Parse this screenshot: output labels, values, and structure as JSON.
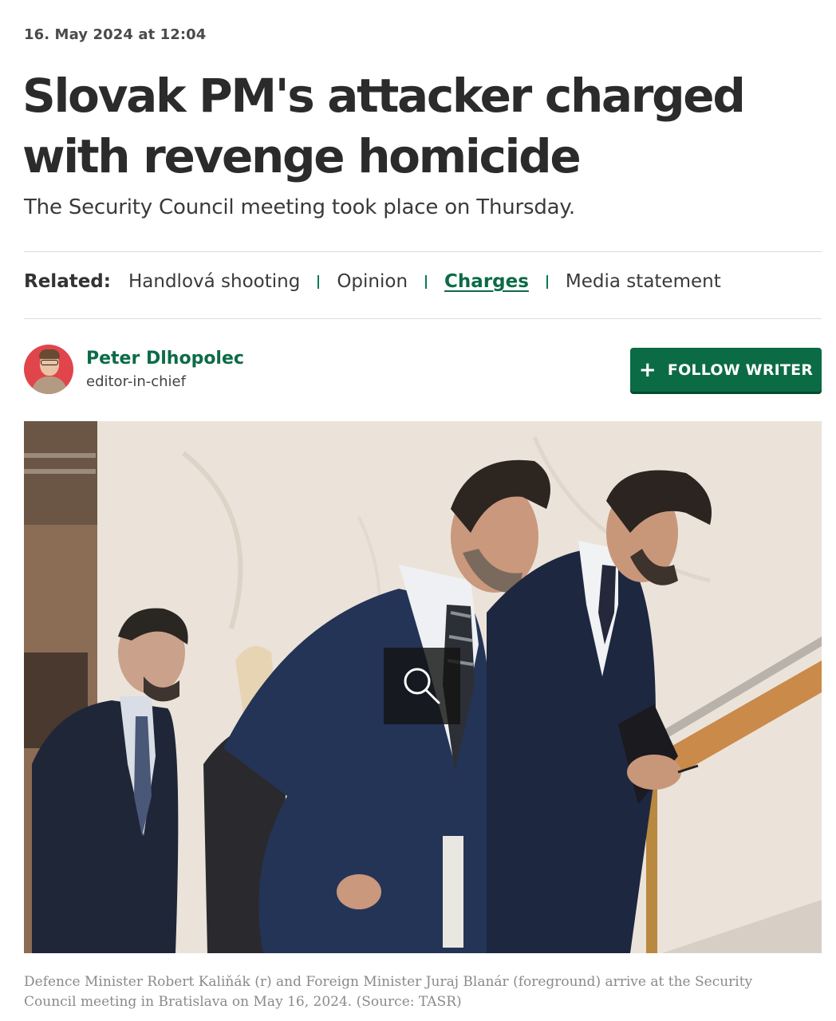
{
  "article": {
    "date": "16. May 2024 at 12:04",
    "headline": "Slovak PM's attacker charged with revenge homicide",
    "subtitle": "The Security Council meeting took place on Thursday."
  },
  "related": {
    "label": "Related:",
    "links": [
      {
        "label": "Handlová shooting",
        "active": false
      },
      {
        "label": "Opinion",
        "active": false
      },
      {
        "label": "Charges",
        "active": true
      },
      {
        "label": "Media statement",
        "active": false
      }
    ]
  },
  "author": {
    "name": "Peter Dlhopolec",
    "role": "editor-in-chief"
  },
  "follow_button": {
    "icon": "plus-icon",
    "label": "FOLLOW WRITER"
  },
  "photo": {
    "zoom_icon": "magnifier-icon",
    "caption": "Defence Minister Robert Kaliňák (r) and Foreign Minister Juraj Blanár (foreground) arrive at the Security Council meeting in Bratislava on May 16, 2024. (Source: TASR)"
  },
  "colors": {
    "accent": "#0b6b45",
    "text": "#2b2b2b",
    "caption": "#8a8a8a",
    "avatar_bg": "#e0454b"
  }
}
